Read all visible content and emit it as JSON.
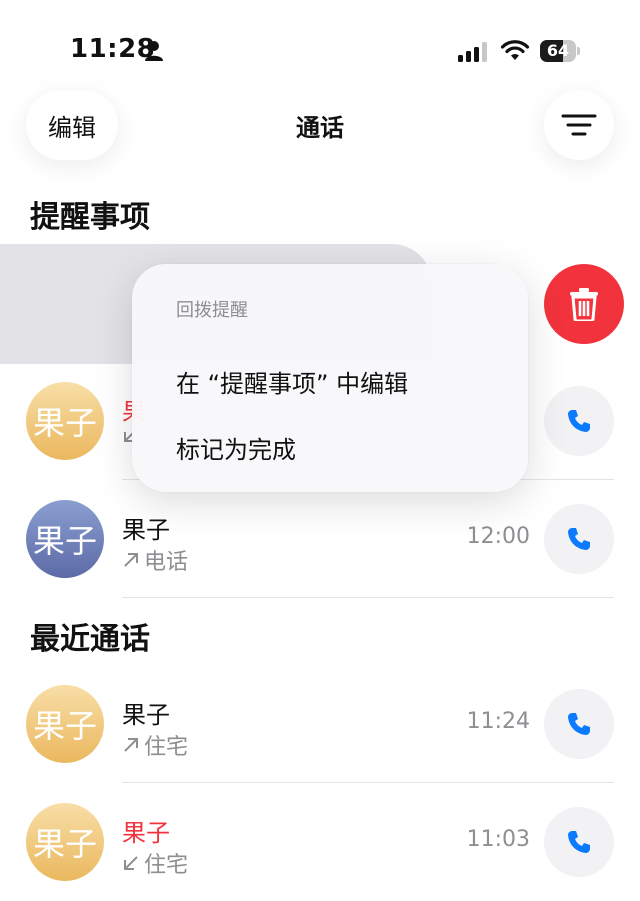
{
  "status_bar": {
    "time": "11:28",
    "battery": "64",
    "battery_fraction": 0.64
  },
  "nav": {
    "edit_label": "编辑",
    "title": "通话"
  },
  "sections": {
    "reminders": "提醒事项",
    "recents": "最近通话"
  },
  "reminder_rows": [
    {
      "name": "果",
      "type": "",
      "time": "",
      "missed": true,
      "avatar_text": "果子",
      "avatar_color": "orange"
    },
    {
      "name": "果子",
      "type": "电话",
      "time": "12:00",
      "missed": false,
      "avatar_text": "果子",
      "avatar_color": "blue"
    }
  ],
  "recent_rows": [
    {
      "name": "果子",
      "type": "住宅",
      "time": "11:24",
      "missed": false,
      "direction": "outgoing",
      "avatar_text": "果子",
      "avatar_color": "orange"
    },
    {
      "name": "果子",
      "type": "住宅",
      "time": "11:03",
      "missed": true,
      "direction": "incoming",
      "avatar_text": "果子",
      "avatar_color": "orange"
    }
  ],
  "context_menu": {
    "header": "回拨提醒",
    "items": [
      "在 “提醒事项” 中编辑",
      "标记为完成"
    ]
  },
  "colors": {
    "missed": "#f2333d",
    "accent": "#0a7aff",
    "delete": "#f2333d"
  },
  "icons": {
    "filter": "filter-lines-icon",
    "call": "phone-icon",
    "delete": "trash-icon",
    "outgoing": "arrow-up-right-icon",
    "incoming": "arrow-down-left-icon"
  }
}
